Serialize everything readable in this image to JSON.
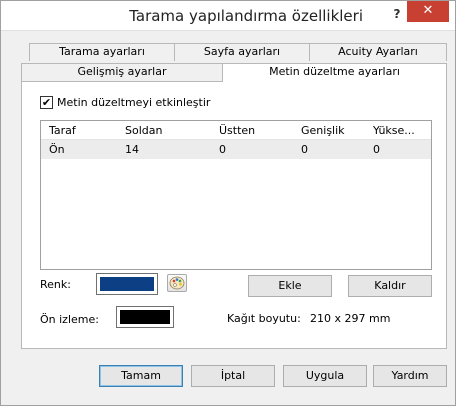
{
  "window": {
    "title": "Tarama yapılandırma özellikleri",
    "help_label": "?",
    "close_label": "✕"
  },
  "tabs": {
    "row1": [
      "Tarama ayarları",
      "Sayfa ayarları",
      "Acuity Ayarları"
    ],
    "row2": [
      "Gelişmiş ayarlar",
      "Metin düzeltme ayarları"
    ],
    "active": "Metin düzeltme ayarları"
  },
  "panel": {
    "enable_checkbox": {
      "label": "Metin düzeltmeyi etkinleştir",
      "checked": true,
      "mark": "✔"
    },
    "grid": {
      "columns": [
        "Taraf",
        "Soldan",
        "Üstten",
        "Genişlik",
        "Yükse..."
      ],
      "rows": [
        [
          "Ön",
          "14",
          "0",
          "0",
          "0"
        ]
      ]
    },
    "color_label": "Renk:",
    "color_value": "#0c3f84",
    "palette_icon": "palette-icon",
    "add_button": "Ekle",
    "remove_button": "Kaldır",
    "preview_label": "Ön izleme:",
    "preview_value": "#000000",
    "paper_size_label": "Kağıt boyutu:",
    "paper_size_value": "210 x 297 mm"
  },
  "footer": {
    "ok": "Tamam",
    "cancel": "İptal",
    "apply": "Uygula",
    "help": "Yardım"
  },
  "colors": {
    "close_bg": "#c84031",
    "default_button_border": "#3c7fb1"
  }
}
